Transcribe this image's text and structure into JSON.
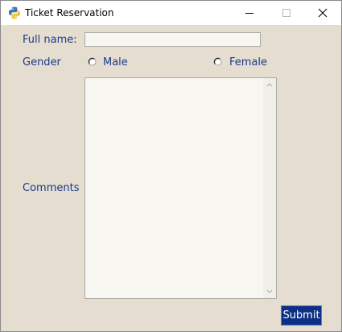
{
  "window": {
    "title": "Ticket Reservation",
    "app_icon": "python-icon",
    "controls": [
      "minimize-icon",
      "maximize-icon",
      "close-icon"
    ]
  },
  "form": {
    "full_name_label": "Full name:",
    "full_name_value": "",
    "gender_label": "Gender",
    "gender_options": [
      "Male",
      "Female"
    ],
    "gender_selected": "",
    "comments_label": "Comments",
    "comments_value": "",
    "submit_label": "Submit"
  },
  "colors": {
    "background": "#e4ddd0",
    "label_text": "#1c3a8c",
    "submit_bg": "#0d2f86",
    "submit_text": "#ffffff",
    "input_bg": "#f8f6f1"
  }
}
